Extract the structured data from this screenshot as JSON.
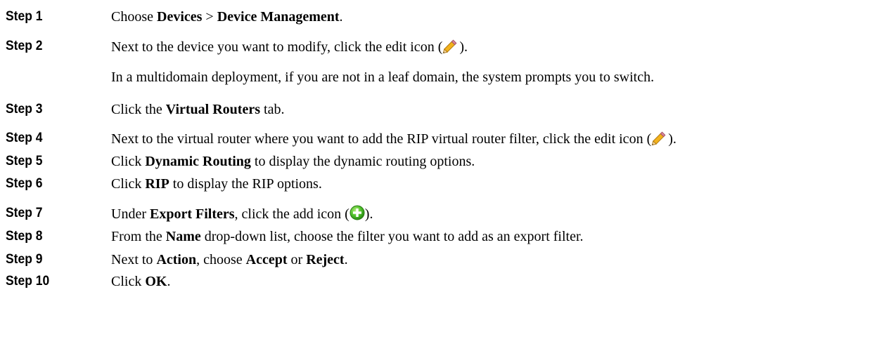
{
  "steps": [
    {
      "label": "Step 1",
      "p1": "Choose ",
      "b1": "Devices",
      "p2": " > ",
      "b2": "Device Management",
      "p3": "."
    },
    {
      "label": "Step 2",
      "p1": "Next to the device you want to modify, click the edit icon (",
      "p2": ").",
      "note": "In a multidomain deployment, if you are not in a leaf domain, the system prompts you to switch."
    },
    {
      "label": "Step 3",
      "p1": "Click the ",
      "b1": "Virtual Routers",
      "p2": " tab."
    },
    {
      "label": "Step 4",
      "p1": "Next to the virtual router where you want to add the RIP virtual router filter, click the edit icon (",
      "p2": ")."
    },
    {
      "label": "Step 5",
      "p1": "Click ",
      "b1": "Dynamic Routing",
      "p2": " to display the dynamic routing options."
    },
    {
      "label": "Step 6",
      "p1": "Click ",
      "b1": "RIP",
      "p2": " to display the RIP options."
    },
    {
      "label": "Step 7",
      "p1": "Under ",
      "b1": "Export Filters",
      "p2": ", click the add icon (",
      "p3": ")."
    },
    {
      "label": "Step 8",
      "p1": "From the ",
      "b1": "Name",
      "p2": " drop-down list, choose the filter you want to add as an export filter."
    },
    {
      "label": "Step 9",
      "p1": "Next to ",
      "b1": "Action",
      "p2": ", choose ",
      "b2": "Accept",
      "p3": " or ",
      "b3": "Reject",
      "p4": "."
    },
    {
      "label": "Step 10",
      "p1": "Click ",
      "b1": "OK",
      "p2": "."
    }
  ],
  "icons": {
    "edit": "pencil-edit-icon",
    "add": "green-plus-add-icon"
  }
}
